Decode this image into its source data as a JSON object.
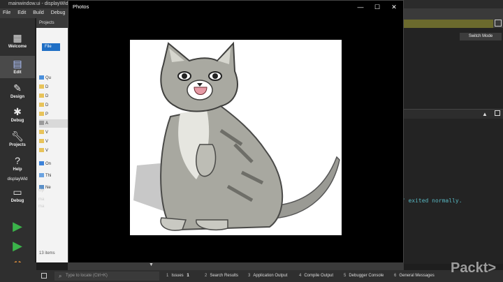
{
  "qt": {
    "title": "mainwindow.ui - displayWid - Qt C",
    "menu": [
      "File",
      "Edit",
      "Build",
      "Debug"
    ],
    "projects_label": "Projects",
    "modes": [
      {
        "label": "Welcome",
        "icon": "grid-icon"
      },
      {
        "label": "Edit",
        "icon": "document-icon"
      },
      {
        "label": "Design",
        "icon": "pen-icon"
      },
      {
        "label": "Debug",
        "icon": "bug-icon"
      },
      {
        "label": "Projects",
        "icon": "wrench-icon"
      },
      {
        "label": "Help",
        "icon": "help-icon"
      }
    ],
    "kit_label": "displayWid",
    "kit_mode": "Debug",
    "switch_mode": "Switch Mode",
    "output_line": "e\" exited normally."
  },
  "explorer": {
    "file_tab": "File",
    "quick_access": "Qu",
    "rows": [
      "D",
      "D",
      "D",
      "P",
      "A",
      "V",
      "V",
      "V",
      "On",
      "Thi",
      "Ne"
    ],
    "item_count": "13 items",
    "side_texts": [
      "Op",
      "ma",
      "ma"
    ]
  },
  "photos": {
    "title": "Photos",
    "minimize": "—",
    "maximize": "☐",
    "close": "✕"
  },
  "statusbar": {
    "search_placeholder": "Type to locate (Ctrl+K)",
    "tabs": [
      {
        "num": "1",
        "label": "Issues",
        "badge": "1"
      },
      {
        "num": "2",
        "label": "Search Results"
      },
      {
        "num": "3",
        "label": "Application Output"
      },
      {
        "num": "4",
        "label": "Compile Output"
      },
      {
        "num": "5",
        "label": "Debugger Console"
      },
      {
        "num": "6",
        "label": "General Messages"
      }
    ]
  },
  "watermark": "Packt>"
}
